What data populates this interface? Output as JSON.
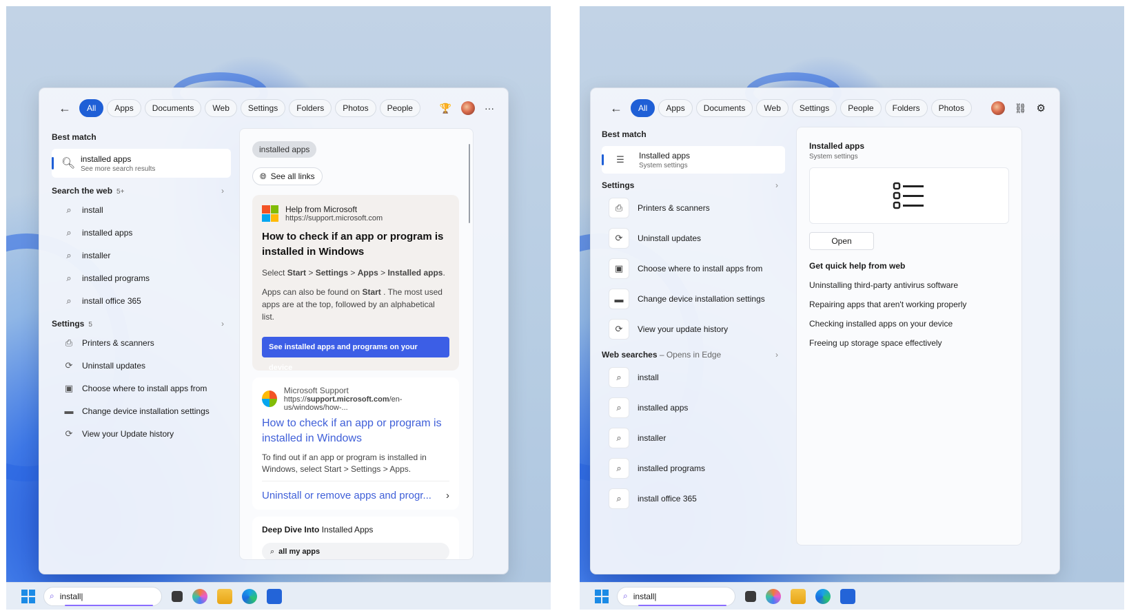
{
  "left": {
    "taskbar_search": "install|",
    "tabs": [
      "All",
      "Apps",
      "Documents",
      "Web",
      "Settings",
      "Folders",
      "Photos",
      "People"
    ],
    "best_match_label": "Best match",
    "best_match": {
      "title": "installed apps",
      "subtitle": "See more search results"
    },
    "search_web": {
      "label": "Search the web",
      "count": "5+",
      "items": [
        "install",
        "installed apps",
        "installer",
        "installed programs",
        "install office 365"
      ]
    },
    "settings": {
      "label": "Settings",
      "count": "5",
      "items": [
        "Printers & scanners",
        "Uninstall updates",
        "Choose where to install apps from",
        "Change device installation settings",
        "View your Update history"
      ]
    },
    "right": {
      "chip": "installed apps",
      "see_all": "See all links",
      "card1": {
        "source": "Help from Microsoft",
        "url": "https://support.microsoft.com",
        "title": "How to check if an app or program is installed in Windows",
        "select_prefix": "Select ",
        "path_start": "Start",
        "sep1": " > ",
        "path_settings": "Settings",
        "sep2": " > ",
        "path_apps": "Apps",
        "sep3": " > ",
        "path_installed": "Installed apps",
        "end_dot": ".",
        "also_prefix": "Apps can also be found on ",
        "also_start": "Start",
        "also_rest": " . The most used apps are at the top, followed by an alphabetical list.",
        "button": "See installed apps and programs on your device"
      },
      "card2": {
        "source": "Microsoft Support",
        "url_prefix": "https://",
        "url_bold": "support.microsoft.com",
        "url_rest": "/en-us/windows/how-...",
        "title": "How to check if an app or program is installed in Windows",
        "snippet": "To find out if an app or program is installed in Windows, select Start > Settings > Apps.",
        "link": "Uninstall or remove apps and progr..."
      },
      "card3": {
        "title_bold": "Deep Dive Into",
        "title_rest": " Installed Apps",
        "search": "all my apps"
      }
    }
  },
  "right": {
    "taskbar_search": "install|",
    "tabs": [
      "All",
      "Apps",
      "Documents",
      "Web",
      "Settings",
      "People",
      "Folders",
      "Photos"
    ],
    "best_match_label": "Best match",
    "best_match": {
      "title": "Installed apps",
      "subtitle": "System settings"
    },
    "settings": {
      "label": "Settings",
      "items": [
        "Printers & scanners",
        "Uninstall updates",
        "Choose where to install apps from",
        "Change device installation settings",
        "View your update history"
      ]
    },
    "web_searches": {
      "label": "Web searches",
      "suffix": " – Opens in Edge",
      "items": [
        "install",
        "installed apps",
        "installer",
        "installed programs",
        "install office 365"
      ]
    },
    "detail": {
      "title": "Installed apps",
      "subtitle": "System settings",
      "open": "Open",
      "quick_help": "Get quick help from web",
      "items": [
        "Uninstalling third-party antivirus software",
        "Repairing apps that aren't working properly",
        "Checking installed apps on your device",
        "Freeing up storage space effectively"
      ]
    }
  },
  "colors": {
    "accent": "#1f5fd6",
    "link": "#3f5fd8",
    "cta": "#3c5ee6"
  }
}
